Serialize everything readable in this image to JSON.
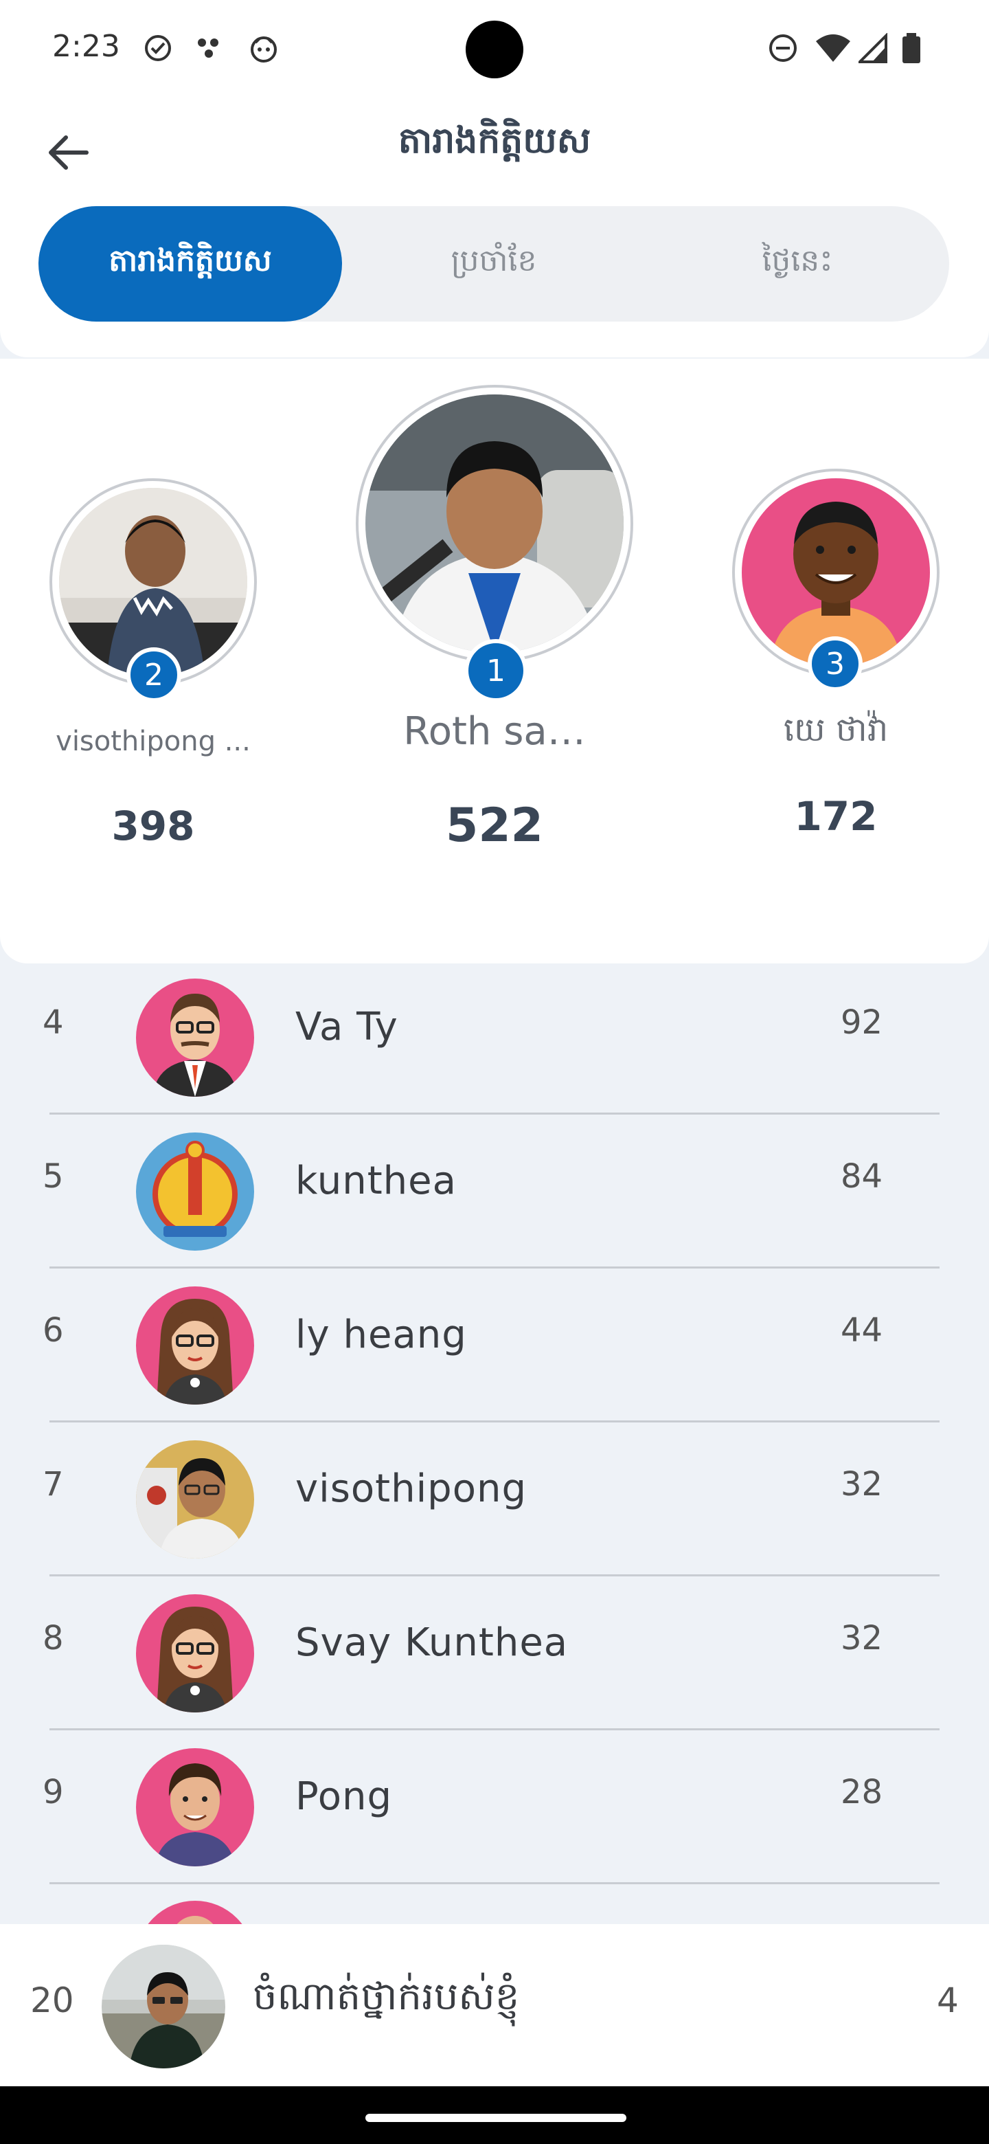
{
  "status_bar": {
    "time": "2:23",
    "icons": [
      "check-circle-icon",
      "dots-icon",
      "android-icon",
      "dnd-icon",
      "wifi-icon",
      "signal-icon",
      "battery-icon"
    ]
  },
  "header": {
    "title": "តារាងកិត្តិយស",
    "tabs": [
      {
        "label": "តារាងកិត្តិយស",
        "active": true
      },
      {
        "label": "ប្រចាំខែ",
        "active": false
      },
      {
        "label": "ថ្ងៃនេះ",
        "active": false
      }
    ]
  },
  "podium": [
    {
      "rank": "1",
      "name": "Roth sa…",
      "score": "522"
    },
    {
      "rank": "2",
      "name": "visothipong ...",
      "score": "398"
    },
    {
      "rank": "3",
      "name": "យេ ថាវ៉ា",
      "score": "172"
    }
  ],
  "list": [
    {
      "rank": "4",
      "name": "Va Ty",
      "score": "92",
      "avatar": "man-suit-avatar"
    },
    {
      "rank": "5",
      "name": "kunthea",
      "score": "84",
      "avatar": "emblem-avatar"
    },
    {
      "rank": "6",
      "name": "ly heang",
      "score": "44",
      "avatar": "woman-glasses-avatar"
    },
    {
      "rank": "7",
      "name": "visothipong",
      "score": "32",
      "avatar": "photo-avatar"
    },
    {
      "rank": "8",
      "name": "Svay Kunthea",
      "score": "32",
      "avatar": "woman-glasses-avatar"
    },
    {
      "rank": "9",
      "name": "Pong",
      "score": "28",
      "avatar": "young-man-avatar"
    }
  ],
  "my_rank": {
    "rank": "20",
    "label": "ចំណាត់ថ្នាក់របស់ខ្ញុំ",
    "score": "4"
  },
  "colors": {
    "accent": "#0a6bbd",
    "avatar_pink": "#e94f86",
    "background": "#eef2f7"
  }
}
